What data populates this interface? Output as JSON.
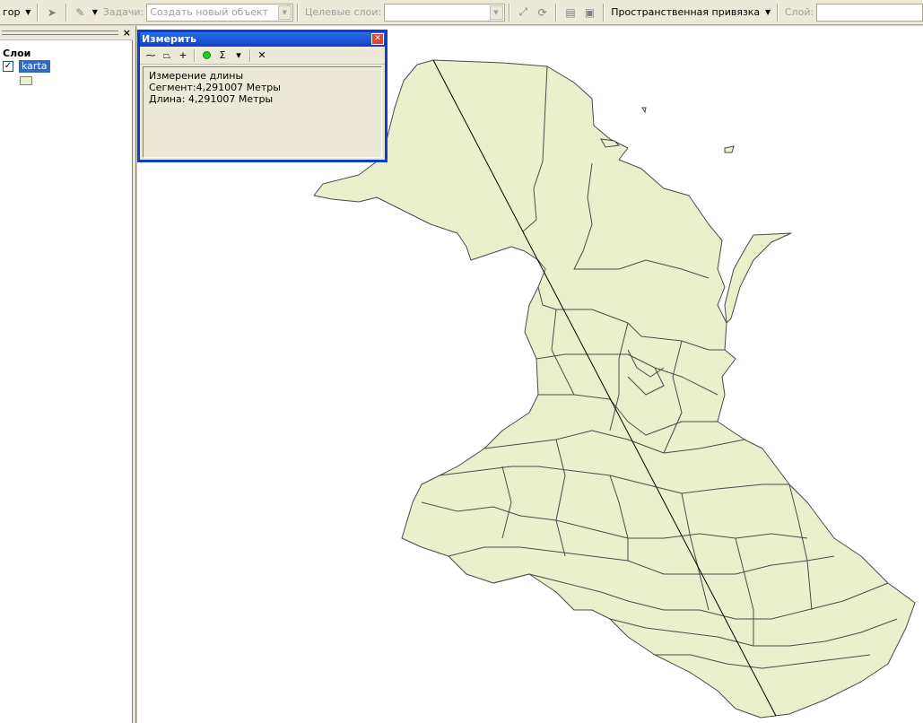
{
  "toolbar": {
    "editor_label": "гор",
    "tasks_label": "Задачи:",
    "tasks_value": "Создать новый объект",
    "target_label": "Целевые слои:",
    "target_value": "",
    "snapping_label": "Пространственная привязка",
    "layer_label": "Слой:",
    "layer_value": ""
  },
  "toc": {
    "title": "Слои",
    "layer_name": "karta",
    "layer_checked": true,
    "swatch_color": "#e9f0cb"
  },
  "dialog": {
    "title": "Измерить",
    "lines": [
      "Измерение длины",
      "Сегмент:4,291007 Метры",
      "Длина: 4,291007 Метры"
    ]
  },
  "map": {
    "fill_color": "#e9f0cb",
    "stroke_color": "#4a4a4a"
  }
}
